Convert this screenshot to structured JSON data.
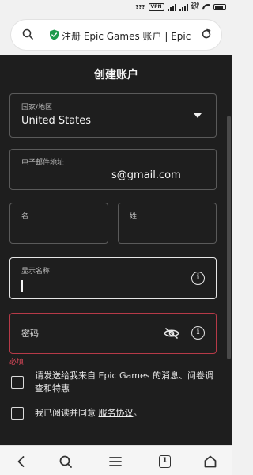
{
  "status_bar": {
    "left_block": "???",
    "vpn": "VPN",
    "mini_top": "200",
    "mini_bottom": "K/S"
  },
  "browser": {
    "url_title": "注册 Epic Games 账户 | Epic"
  },
  "form": {
    "title": "创建账户",
    "country": {
      "label": "国家/地区",
      "value": "United States"
    },
    "email": {
      "label": "电子邮件地址",
      "value": "s@gmail.com"
    },
    "first_name": {
      "label": "名"
    },
    "last_name": {
      "label": "姓"
    },
    "display_name": {
      "label": "显示名称",
      "info": "i"
    },
    "password": {
      "label": "密码",
      "info": "i",
      "error": "必填"
    },
    "newsletter_text": "请发送给我来自 Epic Games 的消息、问卷调查和特惠",
    "tos_prefix": "我已阅读并同意 ",
    "tos_link": "服务协议",
    "tos_suffix": "。"
  },
  "nav": {
    "tabs_count": "1"
  },
  "colors": {
    "page_bg": "#1e1e1e",
    "error": "#e0485a",
    "password_border": "#b73a48"
  }
}
